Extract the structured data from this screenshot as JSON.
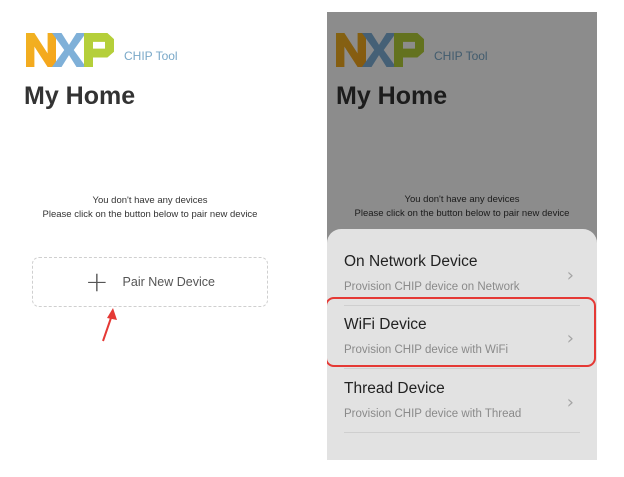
{
  "app": {
    "logo_text": "NXP",
    "app_label": "CHIP Tool",
    "page_title": "My Home"
  },
  "empty_state": {
    "line1": "You don't have any devices",
    "line2": "Please click on the button below to pair new device"
  },
  "pair_button": {
    "icon": "plus-icon",
    "label": "Pair New Device"
  },
  "sheet": {
    "options": [
      {
        "title": "On Network Device",
        "subtitle": "Provision CHIP device on Network",
        "icon": "chevron-right-icon"
      },
      {
        "title": "WiFi Device",
        "subtitle": "Provision CHIP device with WiFi",
        "icon": "chevron-right-icon"
      },
      {
        "title": "Thread Device",
        "subtitle": "Provision CHIP device with Thread",
        "icon": "chevron-right-icon"
      }
    ]
  },
  "colors": {
    "nxp_orange": "#f0b323",
    "nxp_blue": "#7fb0d8",
    "nxp_green": "#b5cf3a",
    "annotation_red": "#e53935",
    "sheet_bg": "#e2e2e2"
  }
}
